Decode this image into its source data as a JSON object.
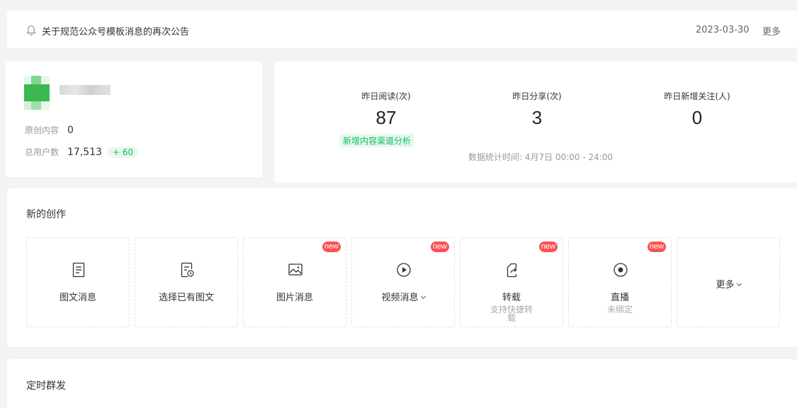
{
  "notice": {
    "title": "关于规范公众号模板消息的再次公告",
    "date": "2023-03-30",
    "more": "更多"
  },
  "profile": {
    "original_label": "原创内容",
    "original_value": "0",
    "users_label": "总用户数",
    "users_value": "17,513",
    "users_delta": "+ 60"
  },
  "stats": {
    "items": [
      {
        "label": "昨日阅读(次)",
        "value": "87"
      },
      {
        "label": "昨日分享(次)",
        "value": "3"
      },
      {
        "label": "昨日新增关注(人)",
        "value": "0"
      }
    ],
    "channel_link": "新增内容渠道分析",
    "time_note": "数据统计时间: 4月7日 00:00 - 24:00"
  },
  "create": {
    "title": "新的创作",
    "new_badge": "new",
    "tiles": [
      {
        "label": "图文消息",
        "icon": "article-icon"
      },
      {
        "label": "选择已有图文",
        "icon": "history-article-icon"
      },
      {
        "label": "图片消息",
        "icon": "image-icon",
        "new": true
      },
      {
        "label": "视频消息",
        "icon": "video-play-icon",
        "new": true,
        "dropdown": true
      },
      {
        "label": "转载",
        "sub": "支持快捷转载",
        "icon": "repost-icon",
        "new": true
      },
      {
        "label": "直播",
        "sub": "未绑定",
        "icon": "live-icon",
        "new": true
      },
      {
        "label": "更多",
        "dropdown": true
      }
    ]
  },
  "scheduled": {
    "title": "定时群发"
  },
  "colors": {
    "accent": "#07c160",
    "badge": "#fa5151",
    "background": "#f3f3f5"
  }
}
